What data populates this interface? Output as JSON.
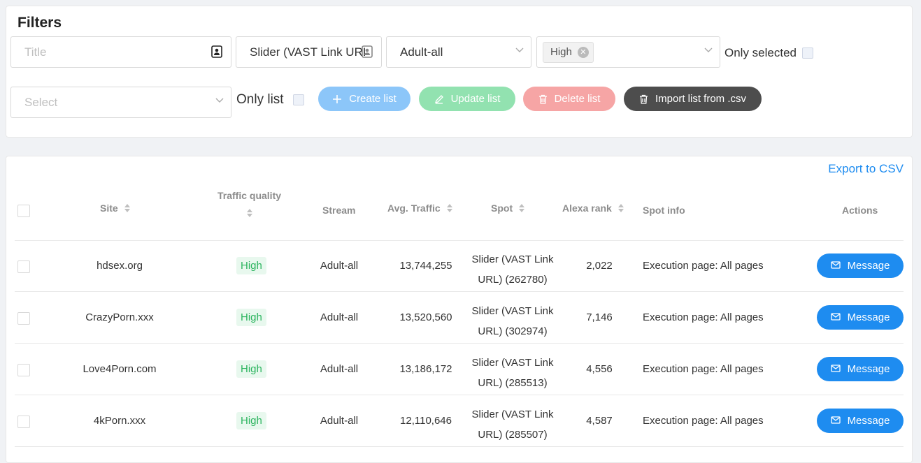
{
  "filters": {
    "title": "Filters",
    "title_placeholder": "Title",
    "spot_value": "Slider (VAST Link URL)",
    "category_value": "Adult-all",
    "quality_tag": "High",
    "only_selected_label": "Only selected",
    "list_placeholder": "Select",
    "only_list_label": "Only list",
    "create_list": "Create list",
    "update_list": "Update list",
    "delete_list": "Delete list",
    "import_list": "Import list from .csv"
  },
  "table": {
    "export_label": "Export to CSV",
    "headers": {
      "site": "Site",
      "traffic_quality": "Traffic quality",
      "stream": "Stream",
      "avg_traffic": "Avg. Traffic",
      "spot": "Spot",
      "alexa_rank": "Alexa rank",
      "spot_info": "Spot info",
      "actions": "Actions"
    },
    "rows": [
      {
        "site": "hdsex.org",
        "quality": "High",
        "stream": "Adult-all",
        "avg_traffic": "13,744,255",
        "spot_line1": "Slider (VAST Link",
        "spot_line2": "URL) (262780)",
        "alexa": "2,022",
        "spot_info": "Execution page: All pages",
        "action": "Message"
      },
      {
        "site": "CrazyPorn.xxx",
        "quality": "High",
        "stream": "Adult-all",
        "avg_traffic": "13,520,560",
        "spot_line1": "Slider (VAST Link",
        "spot_line2": "URL) (302974)",
        "alexa": "7,146",
        "spot_info": "Execution page: All pages",
        "action": "Message"
      },
      {
        "site": "Love4Porn.com",
        "quality": "High",
        "stream": "Adult-all",
        "avg_traffic": "13,186,172",
        "spot_line1": "Slider (VAST Link",
        "spot_line2": "URL) (285513)",
        "alexa": "4,556",
        "spot_info": "Execution page: All pages",
        "action": "Message"
      },
      {
        "site": "4kPorn.xxx",
        "quality": "High",
        "stream": "Adult-all",
        "avg_traffic": "12,110,646",
        "spot_line1": "Slider (VAST Link",
        "spot_line2": "URL) (285507)",
        "alexa": "4,587",
        "spot_info": "Execution page: All pages",
        "action": "Message"
      }
    ]
  },
  "colors": {
    "primary": "#1e8cf0",
    "success": "#2bb45e",
    "danger": "#f6a5a5",
    "dark": "#4d4d4d"
  },
  "icons": [
    "contact-card-icon",
    "chevron-down-icon",
    "close-circle-icon",
    "plus-icon",
    "edit-icon",
    "trash-icon",
    "sort-icon",
    "mail-icon"
  ]
}
